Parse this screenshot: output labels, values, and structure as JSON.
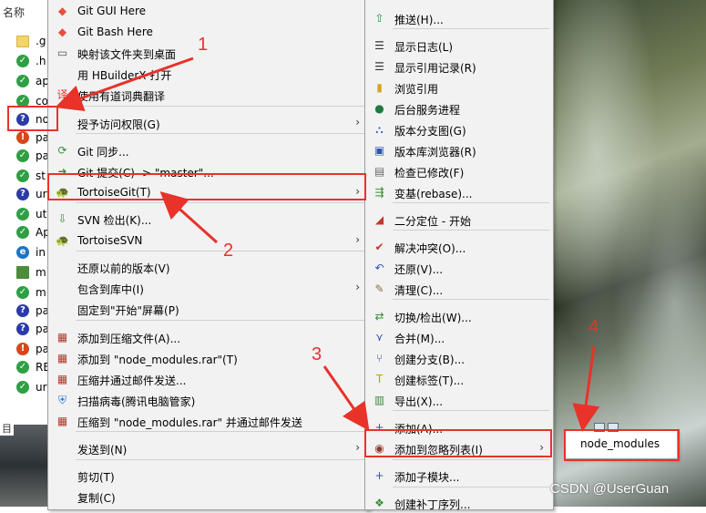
{
  "explorer": {
    "header": "名称",
    "files": [
      {
        "icon": "folder",
        "name": ".g"
      },
      {
        "icon": "ok",
        "name": ".h"
      },
      {
        "icon": "ok",
        "name": "ap"
      },
      {
        "icon": "ok",
        "name": "co"
      },
      {
        "icon": "q",
        "name": "no"
      },
      {
        "icon": "warn",
        "name": "pa"
      },
      {
        "icon": "ok",
        "name": "pa"
      },
      {
        "icon": "ok",
        "name": "st"
      },
      {
        "icon": "q",
        "name": "ur"
      },
      {
        "icon": "ok",
        "name": "ut"
      },
      {
        "icon": "ok",
        "name": "Ap"
      },
      {
        "icon": "ie",
        "name": "in"
      },
      {
        "icon": "img",
        "name": "m"
      },
      {
        "icon": "ok",
        "name": "m"
      },
      {
        "icon": "q",
        "name": "pa"
      },
      {
        "icon": "q",
        "name": "pa"
      },
      {
        "icon": "warn",
        "name": "pa"
      },
      {
        "icon": "ok",
        "name": "RE"
      },
      {
        "icon": "ok",
        "name": "ur"
      }
    ],
    "bottom_label": "目"
  },
  "menu1": {
    "items": [
      {
        "label": "Git GUI Here",
        "icon": "◆",
        "color": "#e94f3a"
      },
      {
        "label": "Git Bash Here",
        "icon": "◆",
        "color": "#e94f3a"
      },
      {
        "label": "映射该文件夹到桌面",
        "icon": "▭",
        "color": "#555"
      },
      {
        "label": "用 HBuilderX 打开",
        "icon": "",
        "color": "#555"
      },
      {
        "label": "使用有道词典翻译",
        "icon": "译",
        "color": "#e5322d"
      },
      {
        "label": "授予访问权限(G)",
        "icon": "",
        "color": "#555"
      },
      {
        "label": "Git 同步...",
        "icon": "⟳",
        "color": "#3c8b3a"
      },
      {
        "label": "Git 提交(C) -> \"master\"...",
        "icon": "➜",
        "color": "#3c8b3a"
      },
      {
        "label": "TortoiseGit(T)",
        "icon": "🐢",
        "color": "#5a7fb4"
      },
      {
        "label": "SVN 检出(K)...",
        "icon": "⇩",
        "color": "#3c8b3a"
      },
      {
        "label": "TortoiseSVN",
        "icon": "🐢",
        "color": "#5a7fb4"
      },
      {
        "label": "还原以前的版本(V)",
        "icon": "",
        "color": "#555"
      },
      {
        "label": "包含到库中(I)",
        "icon": "",
        "color": "#555"
      },
      {
        "label": "固定到\"开始\"屏幕(P)",
        "icon": "",
        "color": "#555"
      },
      {
        "label": "添加到压缩文件(A)...",
        "icon": "▦",
        "color": "#b03a2e"
      },
      {
        "label": "添加到 \"node_modules.rar\"(T)",
        "icon": "▦",
        "color": "#b03a2e"
      },
      {
        "label": "压缩并通过邮件发送...",
        "icon": "▦",
        "color": "#b03a2e"
      },
      {
        "label": "扫描病毒(腾讯电脑管家)",
        "icon": "⛨",
        "color": "#1e6fd9"
      },
      {
        "label": "压缩到 \"node_modules.rar\" 并通过邮件发送",
        "icon": "▦",
        "color": "#b03a2e"
      },
      {
        "label": "发送到(N)",
        "icon": "",
        "color": "#555"
      },
      {
        "label": "剪切(T)",
        "icon": "",
        "color": "#555"
      },
      {
        "label": "复制(C)",
        "icon": "",
        "color": "#555"
      }
    ],
    "submenu_arrow": "›"
  },
  "menu2": {
    "items": [
      {
        "label": "推送(H)...",
        "icon": "⇧",
        "color": "#3c8b3a"
      },
      {
        "label": "显示日志(L)",
        "icon": "☰",
        "color": "#333"
      },
      {
        "label": "显示引用记录(R)",
        "icon": "☰",
        "color": "#333"
      },
      {
        "label": "浏览引用",
        "icon": "▮",
        "color": "#d8a520"
      },
      {
        "label": "后台服务进程",
        "icon": "●",
        "color": "#1f7a3f"
      },
      {
        "label": "版本分支图(G)",
        "icon": "⛬",
        "color": "#2a55b0"
      },
      {
        "label": "版本库浏览器(R)",
        "icon": "▣",
        "color": "#2a55b0"
      },
      {
        "label": "检查已修改(F)",
        "icon": "▤",
        "color": "#666"
      },
      {
        "label": "变基(rebase)...",
        "icon": "⇶",
        "color": "#3c8b3a"
      },
      {
        "label": "二分定位 - 开始",
        "icon": "◢",
        "color": "#c0392b"
      },
      {
        "label": "解决冲突(O)...",
        "icon": "✔",
        "color": "#c0392b"
      },
      {
        "label": "还原(V)...",
        "icon": "↶",
        "color": "#2a55b0"
      },
      {
        "label": "清理(C)...",
        "icon": "✎",
        "color": "#8a6d3b"
      },
      {
        "label": "切换/检出(W)...",
        "icon": "⇄",
        "color": "#3c8b3a"
      },
      {
        "label": "合并(M)...",
        "icon": "⋎",
        "color": "#2a55b0"
      },
      {
        "label": "创建分支(B)...",
        "icon": "⑂",
        "color": "#2a55b0"
      },
      {
        "label": "创建标签(T)...",
        "icon": "T",
        "color": "#c4a000"
      },
      {
        "label": "导出(X)...",
        "icon": "▥",
        "color": "#3c8b3a"
      },
      {
        "label": "添加(A)...",
        "icon": "+",
        "color": "#1e5fc4"
      },
      {
        "label": "添加到忽略列表(I)",
        "icon": "◉",
        "color": "#8b3a2b"
      },
      {
        "label": "添加子模块...",
        "icon": "+",
        "color": "#1e5fc4"
      },
      {
        "label": "创建补丁序列...",
        "icon": "❖",
        "color": "#3c8b3a"
      }
    ],
    "submenu_arrow": "›"
  },
  "menu3": {
    "item": "node_modules"
  },
  "annotations": {
    "step1": "1",
    "step2": "2",
    "step3": "3",
    "step4": "4",
    "color": "#e8322a"
  },
  "watermark": "CSDN @UserGuan"
}
